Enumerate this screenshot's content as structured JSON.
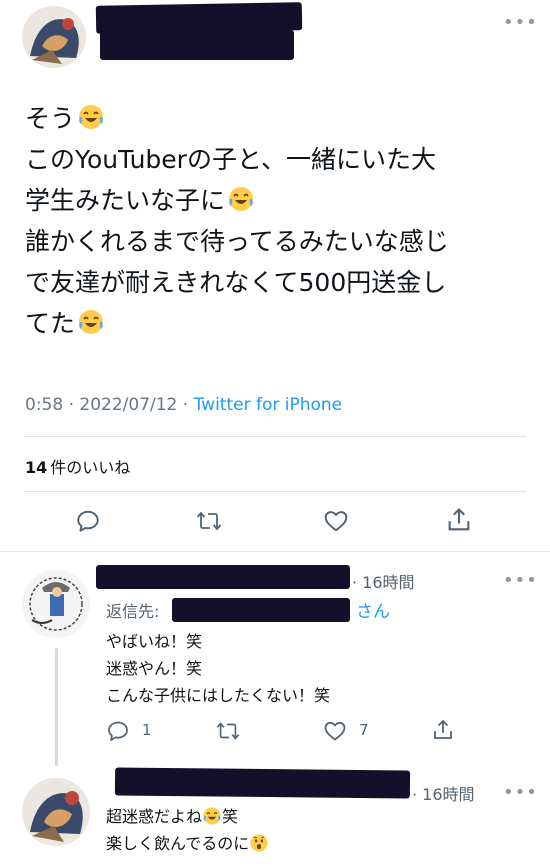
{
  "main_tweet": {
    "lines": [
      {
        "text": "そう",
        "emoji": true
      },
      {
        "text": "このYouTuberの子と、一緒にいた大",
        "emoji": false
      },
      {
        "text": "学生みたいな子に",
        "emoji": true
      },
      {
        "text": "誰かくれるまで待ってるみたいな感じ",
        "emoji": false
      },
      {
        "text": "で友達が耐えきれなくて500円送金し",
        "emoji": false
      },
      {
        "text": "てた",
        "emoji": true
      }
    ],
    "time": "0:58 · 2022/07/12 · ",
    "source": "Twitter for iPhone",
    "likes_count": "14",
    "likes_label": "件のいいね"
  },
  "reply1": {
    "time": "· 16時間",
    "reply_to_label": "返信先:",
    "reply_to_suffix": "さん",
    "lines": [
      "やばいね！笑",
      "迷惑やん！笑",
      "こんな子供にはしたくない！笑"
    ],
    "reply_count": "1",
    "like_count": "7"
  },
  "reply2": {
    "time": "· 16時間",
    "line1_text": "超迷惑だよね",
    "line1_suffix": "笑",
    "line2_text": "楽しく飲んでるのに"
  },
  "icons": [
    "reply-icon",
    "retweet-icon",
    "like-icon",
    "share-icon",
    "more-icon"
  ],
  "colors": {
    "accent": "#1d9bf0",
    "redaction": "#14102a",
    "text": "#0f1419",
    "muted": "#657786"
  }
}
